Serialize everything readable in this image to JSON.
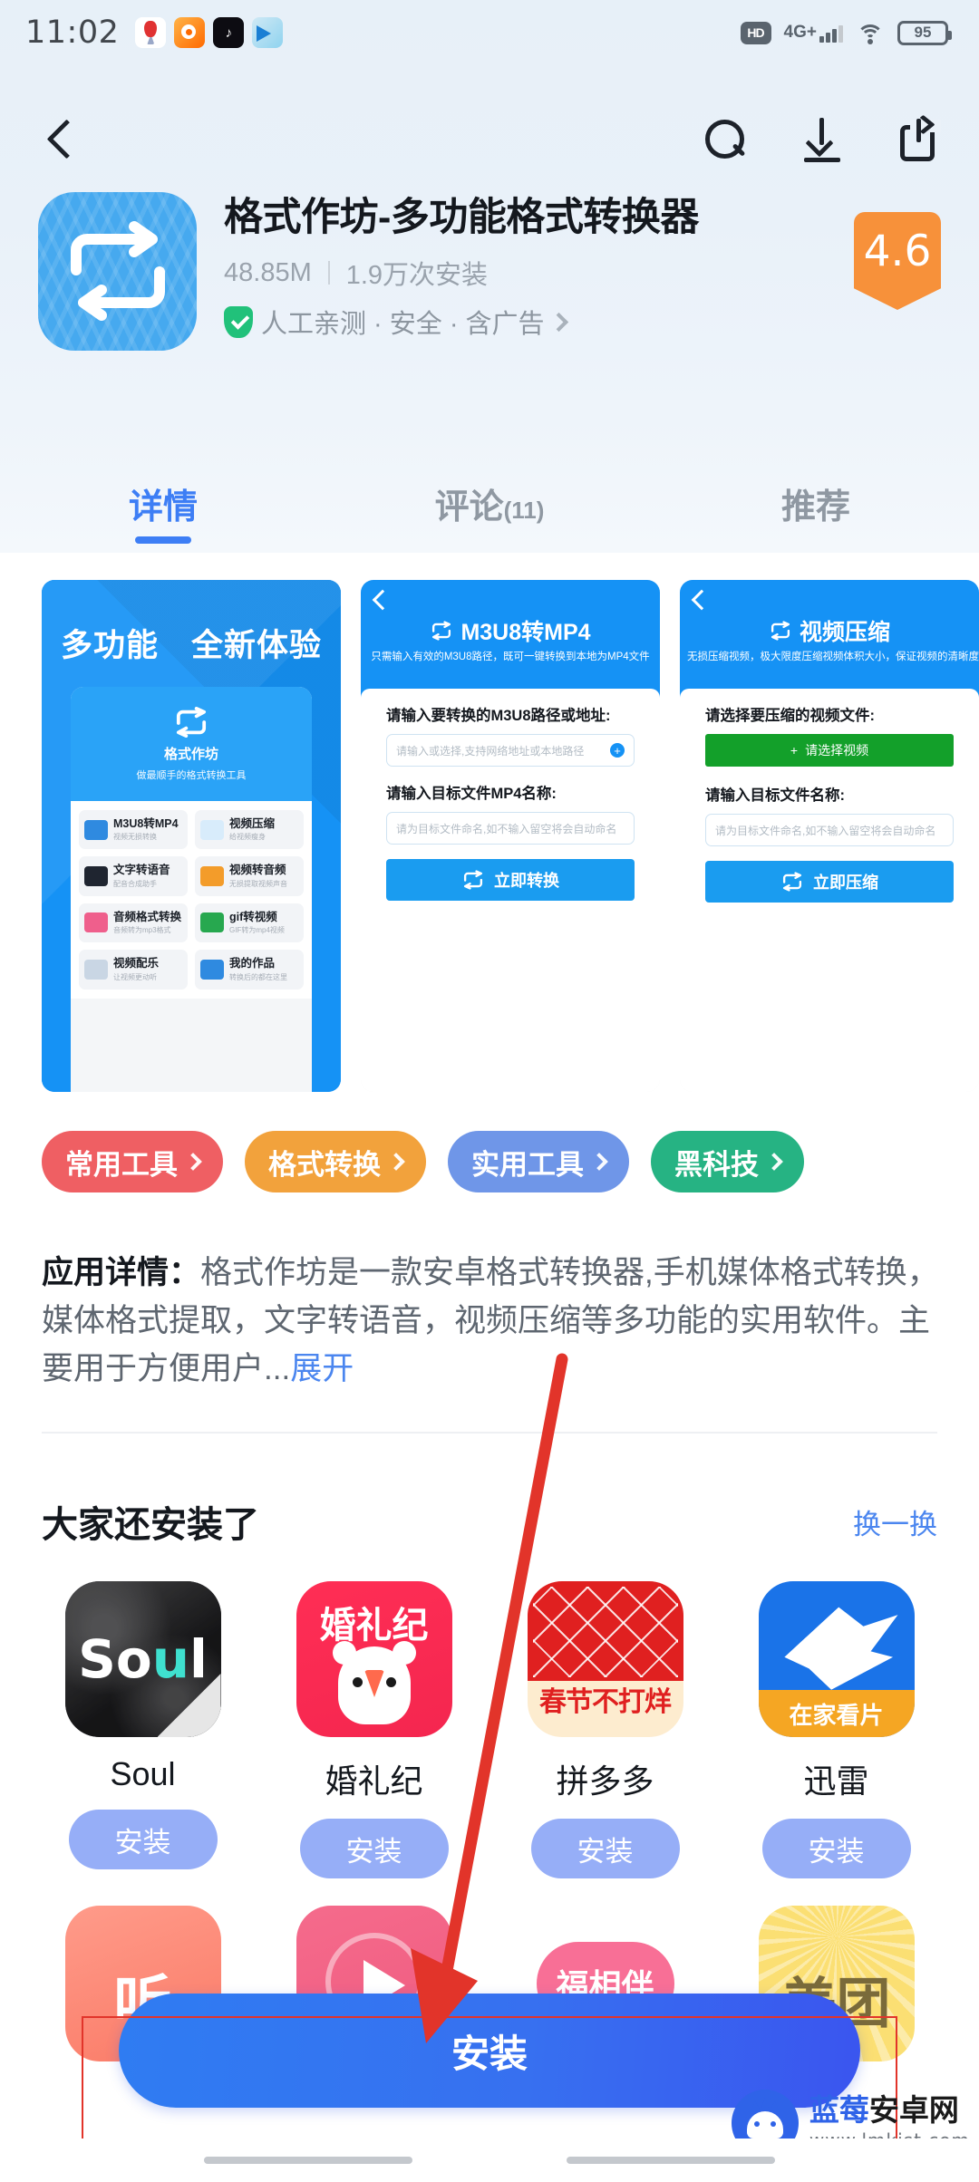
{
  "statusbar": {
    "time": "11:02",
    "left_app_icons": [
      "baidu-map-icon",
      "weibo-icon",
      "douyin-icon",
      "telegram-icon"
    ],
    "hd_label": "HD",
    "network_label": "4G+",
    "wifi_icon": "wifi-icon",
    "battery_level": "95"
  },
  "navbar": {
    "back_icon": "back-chevron-icon",
    "search_icon": "search-icon",
    "download_icon": "download-icon",
    "share_icon": "share-icon"
  },
  "app": {
    "icon": "format-converter-loop-icon",
    "title": "格式作坊-多功能格式转换器",
    "size": "48.85M",
    "installs": "1.9万次安装",
    "safety": "人工亲测 · 安全 · 含广告",
    "safety_chevron": "chevron-right-icon",
    "shield_icon": "verified-shield-icon",
    "rating": "4.6",
    "rating_color": "#f7913a"
  },
  "tabs": [
    {
      "label": "详情",
      "count": "",
      "active": true
    },
    {
      "label": "评论",
      "count": "(11)",
      "active": false
    },
    {
      "label": "推荐",
      "count": "",
      "active": false
    }
  ],
  "screenshots": [
    {
      "name": "screenshot-home",
      "headline": "多功能　全新体验",
      "phone_brand": "格式作坊",
      "phone_tagline": "做最顺手的格式转换工具",
      "features": [
        {
          "title": "M3U8转MP4",
          "sub": "视频无损转换"
        },
        {
          "title": "视频压缩",
          "sub": "给视频瘦身"
        },
        {
          "title": "文字转语音",
          "sub": "配音合成助手"
        },
        {
          "title": "视频转音频",
          "sub": "无损提取视频声音"
        },
        {
          "title": "音频格式转换",
          "sub": "音频转为mp3格式"
        },
        {
          "title": "gif转视频",
          "sub": "GIF转为mp4视频"
        },
        {
          "title": "视频配乐",
          "sub": "让视频更动听"
        },
        {
          "title": "我的作品",
          "sub": "转换后的都在这里"
        }
      ]
    },
    {
      "name": "screenshot-m3u8",
      "title": "M3U8转MP4",
      "desc": "只需输入有效的M3U8路径，既可一键转换到本地为MP4文件",
      "label1": "请输入要转换的M3U8路径或地址:",
      "placeholder1": "请输入或选择,支持网络地址或本地路径",
      "label2": "请输入目标文件MP4名称:",
      "placeholder2": "请为目标文件命名,如不输入留空将会自动命名",
      "button": "立即转换"
    },
    {
      "name": "screenshot-compress",
      "title": "视频压缩",
      "desc": "无损压缩视频，极大限度压缩视频体积大小，保证视频的清晰度",
      "label1": "请选择要压缩的视频文件:",
      "select_button": "请选择视频",
      "label2": "请输入目标文件名称:",
      "placeholder2": "请为目标文件命名,如不输入留空将会自动命名",
      "button": "立即压缩"
    }
  ],
  "tags": [
    {
      "label": "常用工具",
      "color": "#ef5f63"
    },
    {
      "label": "格式转换",
      "color": "#f2a23c"
    },
    {
      "label": "实用工具",
      "color": "#6f96e8"
    },
    {
      "label": "黑科技",
      "color": "#26b383"
    }
  ],
  "description": {
    "label": "应用详情：",
    "body": "格式作坊是一款安卓格式转换器,手机媒体格式转换，媒体格式提取，文字转语音，视频压缩等多功能的实用软件。主要用于方便用户...",
    "more": "展开"
  },
  "recommend": {
    "title": "大家还安装了",
    "refresh": "换一换",
    "install_label": "安装",
    "apps": [
      {
        "name": "Soul",
        "icon": "soul-app-icon"
      },
      {
        "name": "婚礼纪",
        "icon": "hunliji-app-icon"
      },
      {
        "name": "拼多多",
        "icon": "pinduoduo-app-icon",
        "icon_text": "春节不打烊"
      },
      {
        "name": "迅雷",
        "icon": "xunlei-app-icon",
        "icon_text": "在家看片"
      }
    ],
    "apps_row2": [
      {
        "name": "",
        "icon": "ting-app-icon",
        "icon_text": "听"
      },
      {
        "name": "",
        "icon": "video-play-app-icon",
        "icon_text": ""
      },
      {
        "name": "",
        "icon": "fuxiangban-app-icon",
        "icon_text": "福相伴"
      },
      {
        "name": "",
        "icon": "meituan-app-icon",
        "icon_text": "美团"
      }
    ]
  },
  "footer": {
    "install_label": "安装",
    "install_color": "#3770f0"
  },
  "annotation": {
    "arrow_color": "#e2342a",
    "rect_color": "#e2342a"
  },
  "watermark": {
    "logo": "blueberry-android-mascot-icon",
    "name_blue": "蓝莓",
    "name_black": "安卓网",
    "url": "www.lmkjst.com"
  }
}
